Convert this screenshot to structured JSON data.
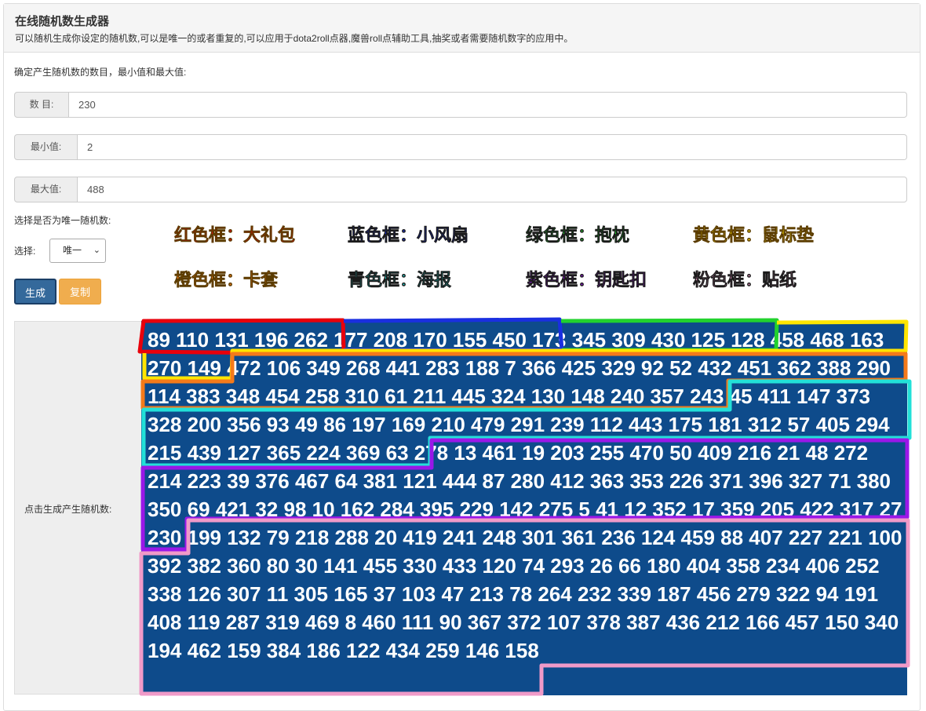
{
  "header": {
    "title": "在线随机数生成器",
    "subtitle": "可以随机生成你设定的随机数,可以是唯一的或者重复的,可以应用于dota2roll点器,魔兽roll点辅助工具,抽奖或者需要随机数字的应用中。"
  },
  "form": {
    "intro": "确定产生随机数的数目，最小值和最大值:",
    "count_label": "数 目:",
    "count_value": "230",
    "min_label": "最小值:",
    "min_value": "2",
    "max_label": "最大值:",
    "max_value": "488",
    "unique_prompt": "选择是否为唯一随机数:",
    "select_label": "选择:",
    "select_value": "唯一",
    "generate_label": "生成",
    "copy_label": "复制",
    "output_label": "点击生成产生随机数:"
  },
  "legend": [
    {
      "text": "红色框：大礼包",
      "color": "#e8000b"
    },
    {
      "text": "蓝色框：小风扇",
      "color": "#1a2fe0"
    },
    {
      "text": "绿色框：抱枕",
      "color": "#22d22e"
    },
    {
      "text": "黄色框：鼠标垫",
      "color": "#ffe500"
    },
    {
      "text": "橙色框：卡套",
      "color": "#f47a1a"
    },
    {
      "text": "青色框：海报",
      "color": "#22e0d8"
    },
    {
      "text": "紫色框：钥匙扣",
      "color": "#9a17e8"
    },
    {
      "text": "粉色框：贴纸",
      "color": "#f09ac8"
    }
  ],
  "output_numbers": "89 110 131 196 262 177 208 170 155 450 173 345 309 430 125 128 458 468 163 270 149 472 106 349 268 441 283 188 7 366 425 329 92 52 432 451 362 388 290 114 383 348 454 258 310 61 211 445 324 130 148 240 357 243 45 411 147 373 328 200 356 93 49 86 197 169 210 479 291 239 112 443 175 181 312 57 405 294 215 439 127 365 224 369 63 278 13 461 19 203 255 470 50 409 216 21 48 272 214 223 39 376 467 64 381 121 444 87 280 412 363 353 226 371 396 327 71 380 350 69 421 32 98 10 162 284 395 229 142 275 5 41 12 352 17 359 205 422 317 27 230 199 132 79 218 288 20 419 241 248 301 361 236 124 459 88 407 227 221 100 392 382 360 80 30 141 455 330 433 120 74 293 26 66 180 404 358 234 406 252 338 126 307 11 305 165 37 103 47 213 78 264 232 339 187 456 279 322 94 191 408 119 287 319 469 8 460 111 90 367 372 107 378 387 436 212 166 457 150 340 194 462 159 384 186 122 434 259 146 158"
}
